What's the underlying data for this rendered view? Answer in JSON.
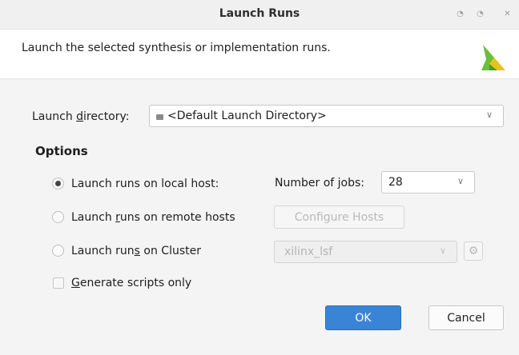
{
  "window": {
    "title": "Launch Runs",
    "controls": [
      "minimize-icon",
      "maximize-icon",
      "close-icon"
    ]
  },
  "header": {
    "description": "Launch the selected synthesis or implementation runs.",
    "logo": "vivado-logo"
  },
  "launch_directory": {
    "label_pre": "Launch ",
    "label_accel": "d",
    "label_post": "irectory:",
    "value": "<Default Launch Directory>"
  },
  "options": {
    "heading": "Options",
    "local": {
      "label_pre": "Launch runs on local host:",
      "selected": true,
      "jobs_label": "Number of jobs:",
      "jobs_value": "28"
    },
    "remote": {
      "label_pre": "Launch ",
      "label_accel": "r",
      "label_post": "uns on remote hosts",
      "selected": false,
      "configure_button": "Configure Hosts"
    },
    "cluster": {
      "label_pre": "Launch run",
      "label_accel": "s",
      "label_post": " on Cluster",
      "selected": false,
      "cluster_value": "xilinx_lsf"
    },
    "scripts_only": {
      "label_accel": "G",
      "label_post": "enerate scripts only",
      "checked": false
    }
  },
  "buttons": {
    "ok": "OK",
    "cancel": "Cancel"
  },
  "colors": {
    "primary": "#3a84d6",
    "logo_green": "#6bbf3a",
    "logo_yellow": "#e8c21a"
  }
}
